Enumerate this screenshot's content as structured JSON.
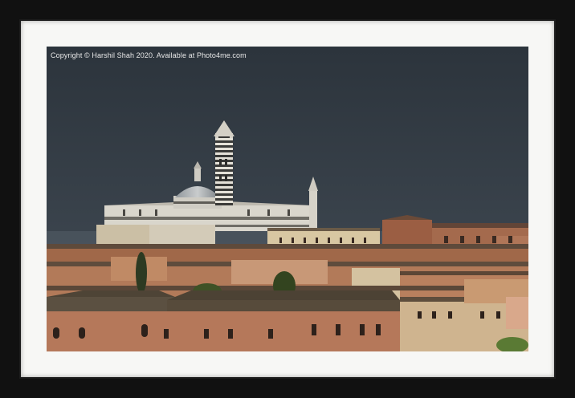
{
  "photo": {
    "caption": "Copyright  © Harshil Shah  2020. Available at Photo4me.com"
  },
  "colors": {
    "frame": "#111111",
    "mount": "#f7f7f5",
    "sky_top": "#2f373f",
    "sky_bottom": "#48525c",
    "brick": "#a86a4c",
    "roof": "#5b4a3a",
    "marble": "#dcdad2"
  }
}
